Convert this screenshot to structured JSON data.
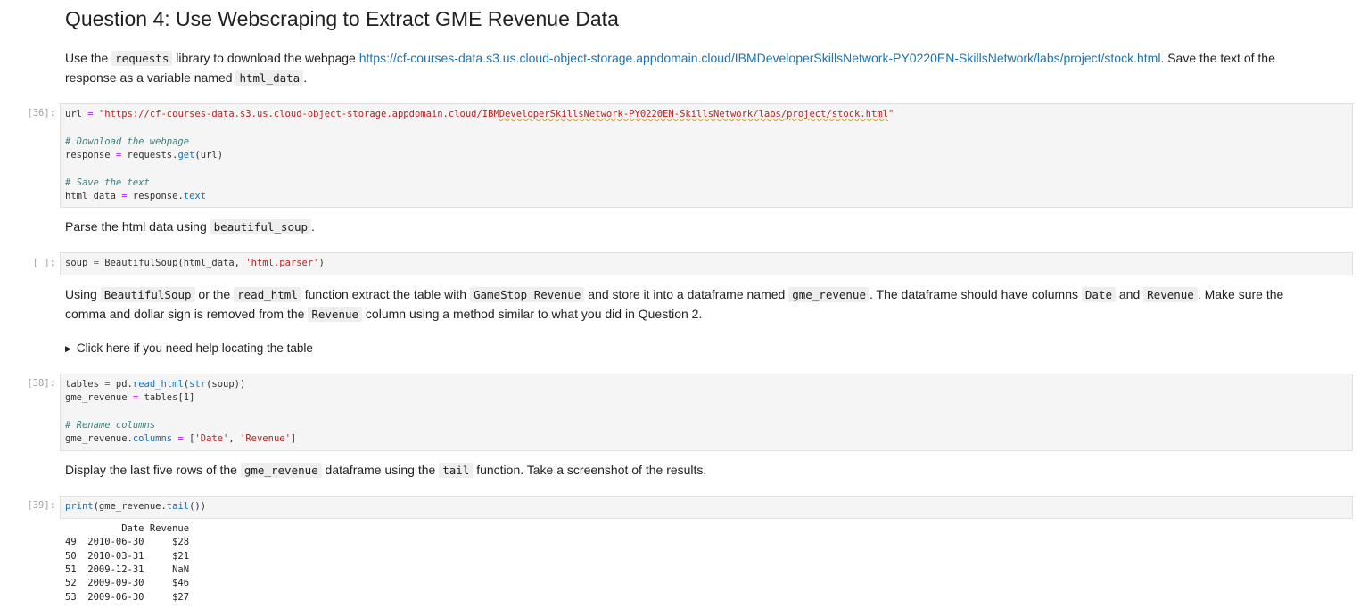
{
  "heading": "Question 4: Use Webscraping to Extract GME Revenue Data",
  "intro": {
    "t1": "Use the ",
    "c1": "requests",
    "t2": " library to download the webpage ",
    "link": "https://cf-courses-data.s3.us.cloud-object-storage.appdomain.cloud/IBMDeveloperSkillsNetwork-PY0220EN-SkillsNetwork/labs/project/stock.html",
    "t3": ". Save the text of the",
    "t4": "response as a variable named ",
    "c2": "html_data",
    "t5": "."
  },
  "cell36": {
    "prompt": "[36]:",
    "l1_var": "url",
    "l1_eq": " = ",
    "l1_str_a": "\"https://cf-courses-data.s3.us.cloud-object-storage.appdomain.cloud/IBM",
    "l1_str_b": "DeveloperSkillsNetwork-PY0220EN-SkillsNetwork/labs/project/stock.html",
    "l1_str_c": "\"",
    "l2": "# Download the webpage",
    "l3_a": "response",
    "l3_eq": " = ",
    "l3_b": "requests.",
    "l3_fn": "get",
    "l3_c": "(url)",
    "l4": "# Save the text",
    "l5_a": "html_data",
    "l5_eq": " = ",
    "l5_b": "response.",
    "l5_attr": "text"
  },
  "parse": {
    "t1": "Parse the html data using ",
    "c1": "beautiful_soup",
    "t2": "."
  },
  "cell_soup": {
    "prompt": "[ ]:",
    "a": "soup",
    "eq": " = ",
    "b": "BeautifulSoup(html_data, ",
    "str": "'html.parser'",
    "c": ")"
  },
  "using": {
    "t1": "Using ",
    "c1": "BeautifulSoup",
    "t2": " or the ",
    "c2": "read_html",
    "t3": " function extract the table with ",
    "c3": "GameStop Revenue",
    "t4": " and store it into a dataframe named ",
    "c4": "gme_revenue",
    "t5": ". The dataframe should have columns ",
    "c5": "Date",
    "t6": " and ",
    "c6": "Revenue",
    "t7": ". Make sure the",
    "t8": "comma and dollar sign is removed from the ",
    "c7": "Revenue",
    "t9": " column using a method similar to what you did in Question 2."
  },
  "details": {
    "arrow": "▶",
    "label": "Click here if you need help locating the table"
  },
  "cell38": {
    "prompt": "[38]:",
    "l1_a": "tables",
    "l1_eq": " = ",
    "l1_b": "pd.",
    "l1_fn": "read_html",
    "l1_c": "(",
    "l1_bi": "str",
    "l1_d": "(soup))",
    "l2_a": "gme_revenue",
    "l2_eq": " = ",
    "l2_b": "tables[1]",
    "l3": "# Rename columns",
    "l4_a": "gme_revenue.",
    "l4_attr": "columns",
    "l4_eq": " = ",
    "l4_b": "[",
    "l4_s1": "'Date'",
    "l4_c": ", ",
    "l4_s2": "'Revenue'",
    "l4_d": "]"
  },
  "display": {
    "t1": "Display the last five rows of the ",
    "c1": "gme_revenue",
    "t2": " dataframe using the ",
    "c2": "tail",
    "t3": " function. Take a screenshot of the results."
  },
  "cell39": {
    "prompt": "[39]:",
    "a": "print",
    "b": "(gme_revenue.",
    "fn": "tail",
    "c": "())"
  },
  "output": {
    "header": "          Date Revenue",
    "rows": [
      "49  2010-06-30     $28",
      "50  2010-03-31     $21",
      "51  2009-12-31     NaN",
      "52  2009-09-30     $46",
      "53  2009-06-30     $27"
    ]
  }
}
